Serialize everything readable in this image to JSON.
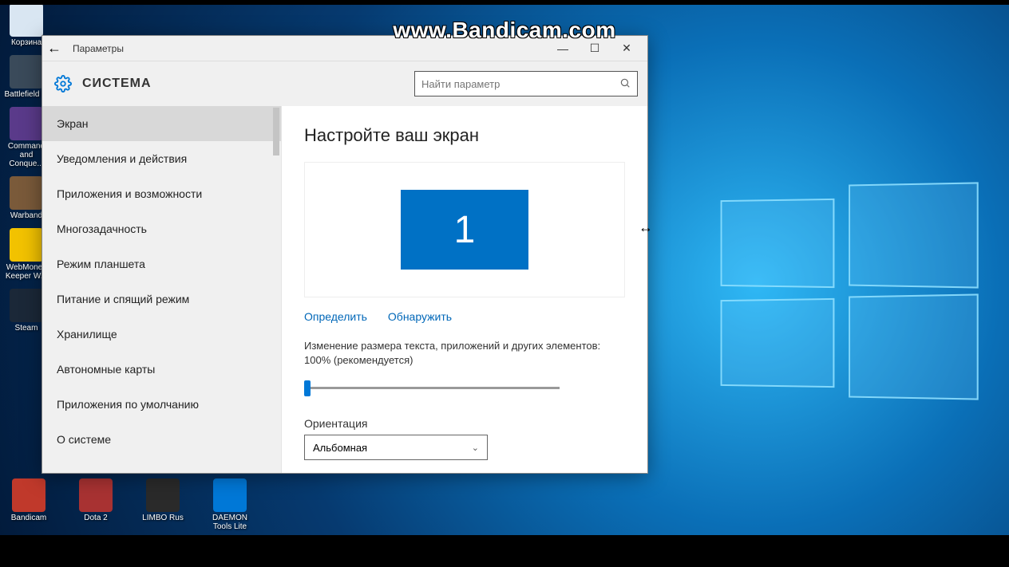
{
  "watermark": "www.Bandicam.com",
  "window": {
    "title": "Параметры",
    "section": "СИСТЕМА",
    "search_placeholder": "Найти параметр"
  },
  "sidebar": {
    "items": [
      {
        "label": "Экран",
        "active": true
      },
      {
        "label": "Уведомления и действия",
        "active": false
      },
      {
        "label": "Приложения и возможности",
        "active": false
      },
      {
        "label": "Многозадачность",
        "active": false
      },
      {
        "label": "Режим планшета",
        "active": false
      },
      {
        "label": "Питание и спящий режим",
        "active": false
      },
      {
        "label": "Хранилище",
        "active": false
      },
      {
        "label": "Автономные карты",
        "active": false
      },
      {
        "label": "Приложения по умолчанию",
        "active": false
      },
      {
        "label": "О системе",
        "active": false
      }
    ]
  },
  "content": {
    "heading": "Настройте ваш экран",
    "monitor_number": "1",
    "link_identify": "Определить",
    "link_detect": "Обнаружить",
    "scale_text": "Изменение размера текста, приложений и других элементов: 100% (рекомендуется)",
    "orientation_label": "Ориентация",
    "orientation_value": "Альбомная"
  },
  "desktop_icons_left": [
    {
      "label": "Корзина",
      "color": "#d9e6f2"
    },
    {
      "label": "Battlefield ...",
      "color": "#3a4a5a"
    },
    {
      "label": "Command and Conque...",
      "color": "#5a3a8a"
    },
    {
      "label": "Warband",
      "color": "#7a5a3a"
    },
    {
      "label": "WebMoney Keeper W...",
      "color": "#f2c200"
    },
    {
      "label": "Steam",
      "color": "#1b2838"
    }
  ],
  "desktop_icons_bottom": [
    {
      "label": "Bandicam",
      "color": "#c0392b"
    },
    {
      "label": "Dota 2",
      "color": "#a83232"
    },
    {
      "label": "LIMBO Rus",
      "color": "#2a2a2a"
    },
    {
      "label": "DAEMON Tools Lite",
      "color": "#0078d7"
    }
  ]
}
